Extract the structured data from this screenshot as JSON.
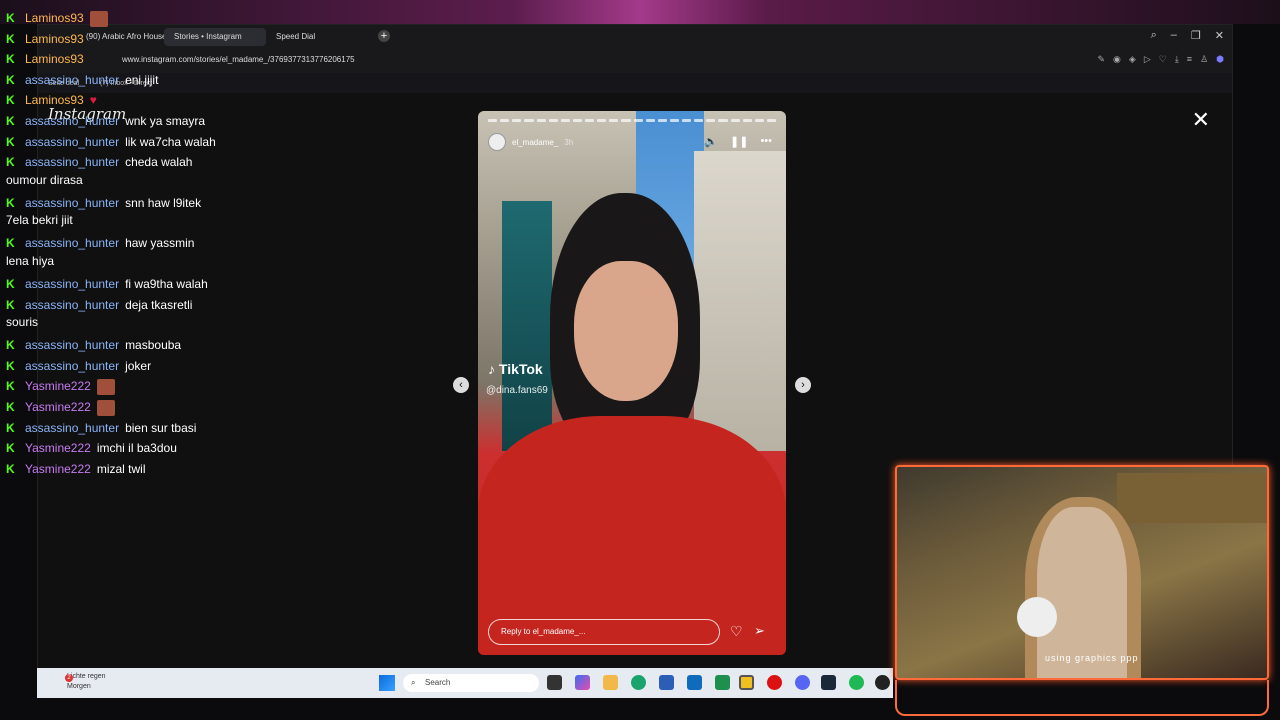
{
  "browser": {
    "tabs": [
      {
        "label": "(90) Arabic Afro House M..."
      },
      {
        "label": "Stories • Instagram"
      },
      {
        "label": "Speed Dial"
      }
    ],
    "url": "www.instagram.com/stories/el_madame_/3769377313776206175",
    "bookmarks": [
      "Seite deal",
      "(7) Inbox • Direct"
    ]
  },
  "instagram": {
    "logo": "Instagram",
    "story": {
      "username": "el_madame_",
      "time": "3h",
      "watermark": "TikTok",
      "watermark_handle": "@dina.fans69",
      "reply_placeholder": "Reply to el_madame_..."
    }
  },
  "chat": [
    {
      "user": "Laminos93",
      "cls": "u-lam",
      "text": "",
      "emote": "emote"
    },
    {
      "user": "Laminos93",
      "cls": "u-lam",
      "text": "",
      "emote": ""
    },
    {
      "user": "Laminos93",
      "cls": "u-lam",
      "text": "",
      "emote": ""
    },
    {
      "user": "assassino_hunter",
      "cls": "u-ass",
      "text": "eni jijit",
      "emote": ""
    },
    {
      "user": "Laminos93",
      "cls": "u-lam",
      "text": "",
      "emote": "heart"
    },
    {
      "user": "assassino_hunter",
      "cls": "u-ass",
      "text": "wnk ya smayra",
      "emote": ""
    },
    {
      "user": "assassino_hunter",
      "cls": "u-ass",
      "text": "lik wa7cha walah",
      "emote": ""
    },
    {
      "user": "assassino_hunter",
      "cls": "u-ass",
      "text": "cheda walah",
      "cont": "oumour dirasa",
      "emote": ""
    },
    {
      "user": "assassino_hunter",
      "cls": "u-ass",
      "text": "snn haw l9itek",
      "cont": "7ela bekri jiit",
      "emote": ""
    },
    {
      "user": "assassino_hunter",
      "cls": "u-ass",
      "text": "haw yassmin",
      "cont": "lena hiya",
      "emote": ""
    },
    {
      "user": "assassino_hunter",
      "cls": "u-ass",
      "text": "fi wa9tha walah",
      "emote": ""
    },
    {
      "user": "assassino_hunter",
      "cls": "u-ass",
      "text": "deja tkasretli",
      "cont": "souris",
      "emote": ""
    },
    {
      "user": "assassino_hunter",
      "cls": "u-ass",
      "text": "masbouba",
      "emote": ""
    },
    {
      "user": "assassino_hunter",
      "cls": "u-ass",
      "text": "joker",
      "emote": ""
    },
    {
      "user": "Yasmine222",
      "cls": "u-yas",
      "text": "",
      "emote": "emote"
    },
    {
      "user": "Yasmine222",
      "cls": "u-yas",
      "text": "",
      "emote": "emote"
    },
    {
      "user": "assassino_hunter",
      "cls": "u-ass",
      "text": "bien sur tbasi",
      "emote": ""
    },
    {
      "user": "Yasmine222",
      "cls": "u-yas",
      "text": "imchi il ba3dou",
      "emote": ""
    },
    {
      "user": "Yasmine222",
      "cls": "u-yas",
      "text": "mizal twil",
      "emote": ""
    }
  ],
  "taskbar": {
    "weather_line1": "Lichte regen",
    "weather_line2": "Morgen",
    "weather_badge": "2",
    "search_placeholder": "Search"
  },
  "webcam": {
    "mirrored_text": "using graphics ppp"
  },
  "colors": {
    "kick_green": "#53fc18",
    "webcam_border": "#ff6a3a"
  }
}
